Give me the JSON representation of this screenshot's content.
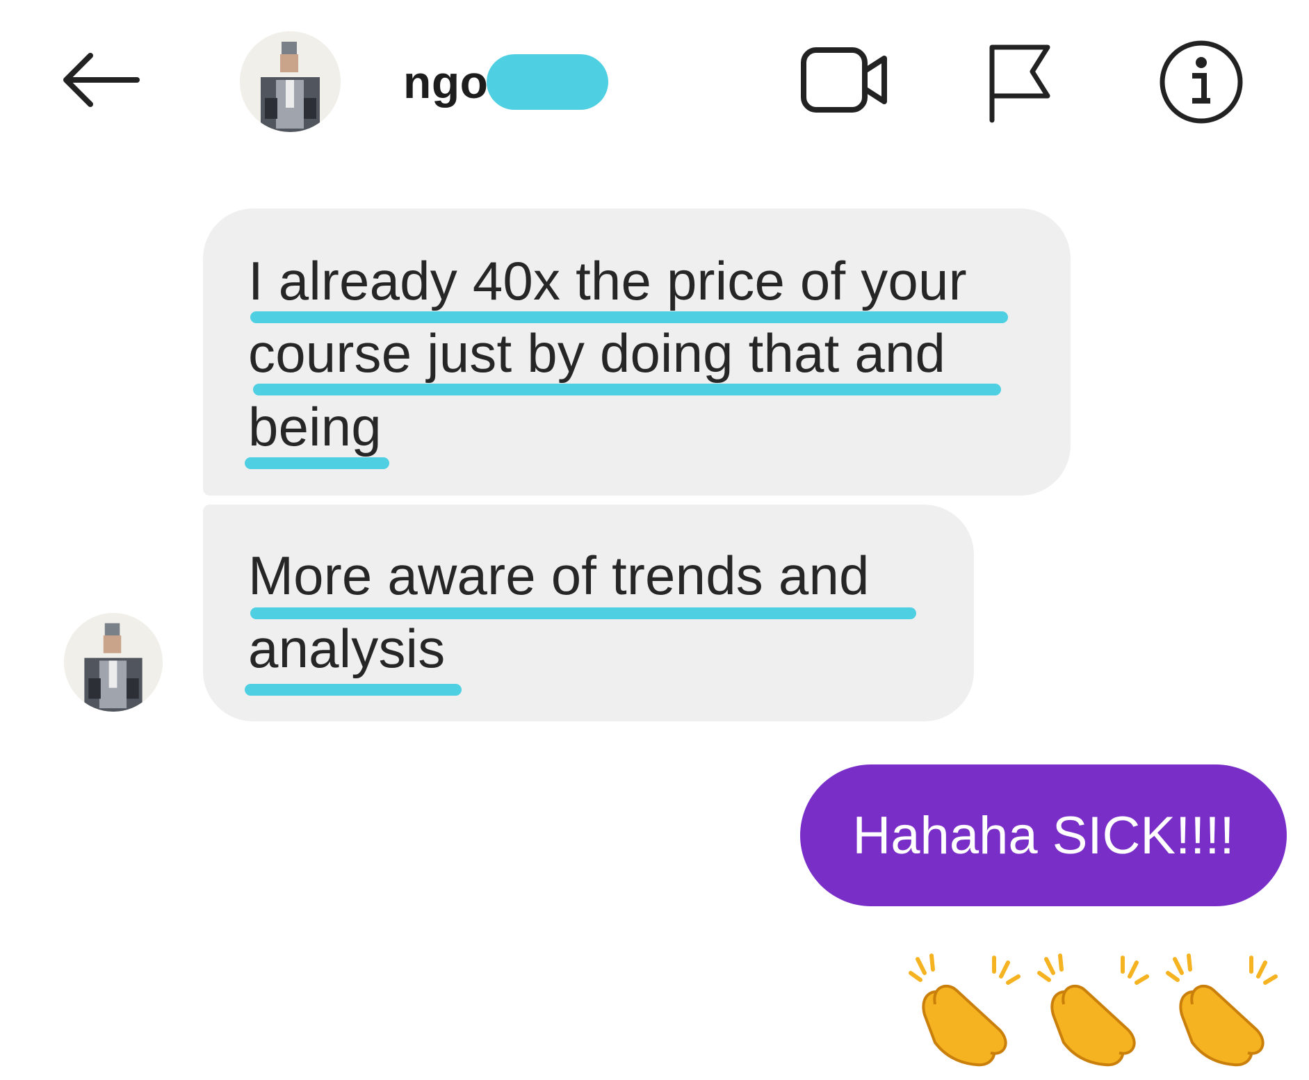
{
  "header": {
    "back_icon": "arrow-left-icon",
    "contact_name": "ngo",
    "actions": [
      {
        "name": "video-call",
        "icon": "video-camera-icon"
      },
      {
        "name": "report",
        "icon": "flag-icon"
      },
      {
        "name": "info",
        "icon": "info-circle-icon"
      }
    ]
  },
  "colors": {
    "highlight": "#4fd0e2",
    "received_bubble": "#efefef",
    "sent_bubble": "#7a2ec8",
    "clap": "#f5b321"
  },
  "messages": {
    "received_1": {
      "lines": [
        "I already 40x the price of your",
        "course just by doing that and",
        "being"
      ]
    },
    "received_2": {
      "lines": [
        "More aware of trends and",
        "analysis"
      ]
    },
    "sent_1": {
      "text": "Hahaha SICK!!!!"
    },
    "sent_reaction": {
      "emoji": "clapping-hands-icon",
      "count": 3
    }
  }
}
